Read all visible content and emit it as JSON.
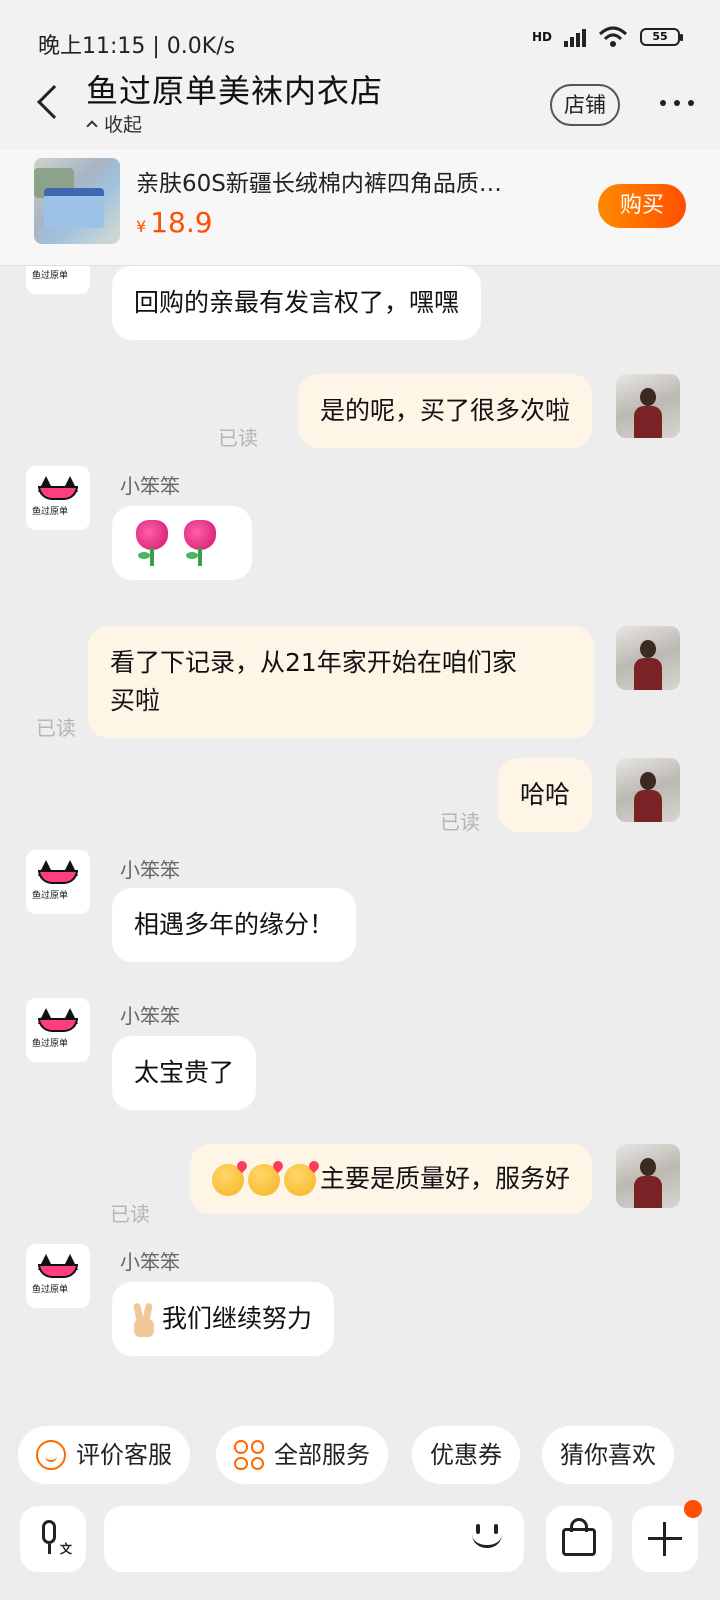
{
  "status_bar": {
    "time": "晚上11:15 | 0.0K/s",
    "network": "HD",
    "battery": "55"
  },
  "header": {
    "title": "鱼过原单美袜内衣店",
    "collapse_label": "收起",
    "store_button": "店铺"
  },
  "product": {
    "title": "亲肤60S新疆长绒棉内裤四角品质…",
    "currency": "¥",
    "price": "18.9",
    "buy_button": "购买"
  },
  "shop_avatar_text": "鱼过原单",
  "messages": [
    {
      "from": "shop",
      "text": "回购的亲最有发言权了，嘿嘿"
    },
    {
      "from": "me",
      "text": "是的呢，买了很多次啦",
      "status": "已读"
    },
    {
      "from": "shop",
      "sender": "小笨笨",
      "emoji": "rose-rose"
    },
    {
      "from": "me",
      "text_line1": "看了下记录，从21年家开始在咱们家",
      "text_line2": "买啦",
      "status": "已读"
    },
    {
      "from": "me",
      "text": "哈哈",
      "status": "已读"
    },
    {
      "from": "shop",
      "sender": "小笨笨",
      "text": "相遇多年的缘分！"
    },
    {
      "from": "shop",
      "sender": "小笨笨",
      "text": "太宝贵了"
    },
    {
      "from": "me",
      "text": "主要是质量好，服务好",
      "status": "已读"
    },
    {
      "from": "shop",
      "sender": "小笨笨",
      "text": "我们继续努力"
    }
  ],
  "quick_actions": [
    {
      "label": "评价客服",
      "icon": "smile-icon"
    },
    {
      "label": "全部服务",
      "icon": "grid-icon"
    },
    {
      "label": "优惠券"
    },
    {
      "label": "猜你喜欢"
    }
  ],
  "input": {
    "voice_label": "文",
    "placeholder": ""
  },
  "colors": {
    "accent": "#ff5000",
    "outgoing_bubble": "#fff5e6",
    "incoming_bubble": "#ffffff",
    "background": "#ededed"
  }
}
